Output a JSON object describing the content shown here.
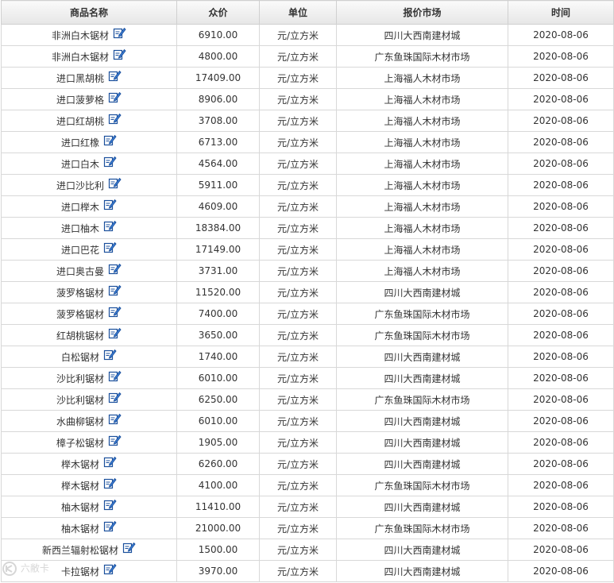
{
  "table": {
    "headers": [
      "商品名称",
      "众价",
      "单位",
      "报价市场",
      "时间"
    ],
    "icon": "edit-note-icon",
    "rows": [
      {
        "name": "非洲白木锯材",
        "price": "6910.00",
        "unit": "元/立方米",
        "market": "四川大西南建材城",
        "date": "2020-08-06"
      },
      {
        "name": "非洲白木锯材",
        "price": "4800.00",
        "unit": "元/立方米",
        "market": "广东鱼珠国际木材市场",
        "date": "2020-08-06"
      },
      {
        "name": "进口黑胡桃",
        "price": "17409.00",
        "unit": "元/立方米",
        "market": "上海福人木材市场",
        "date": "2020-08-06"
      },
      {
        "name": "进口菠萝格",
        "price": "8906.00",
        "unit": "元/立方米",
        "market": "上海福人木材市场",
        "date": "2020-08-06"
      },
      {
        "name": "进口红胡桃",
        "price": "3708.00",
        "unit": "元/立方米",
        "market": "上海福人木材市场",
        "date": "2020-08-06"
      },
      {
        "name": "进口红橡",
        "price": "6713.00",
        "unit": "元/立方米",
        "market": "上海福人木材市场",
        "date": "2020-08-06"
      },
      {
        "name": "进口白木",
        "price": "4564.00",
        "unit": "元/立方米",
        "market": "上海福人木材市场",
        "date": "2020-08-06"
      },
      {
        "name": "进口沙比利",
        "price": "5911.00",
        "unit": "元/立方米",
        "market": "上海福人木材市场",
        "date": "2020-08-06"
      },
      {
        "name": "进口榉木",
        "price": "4609.00",
        "unit": "元/立方米",
        "market": "上海福人木材市场",
        "date": "2020-08-06"
      },
      {
        "name": "进口柚木",
        "price": "18384.00",
        "unit": "元/立方米",
        "market": "上海福人木材市场",
        "date": "2020-08-06"
      },
      {
        "name": "进口巴花",
        "price": "17149.00",
        "unit": "元/立方米",
        "market": "上海福人木材市场",
        "date": "2020-08-06"
      },
      {
        "name": "进口奥古曼",
        "price": "3731.00",
        "unit": "元/立方米",
        "market": "上海福人木材市场",
        "date": "2020-08-06"
      },
      {
        "name": "菠罗格锯材",
        "price": "11520.00",
        "unit": "元/立方米",
        "market": "四川大西南建材城",
        "date": "2020-08-06"
      },
      {
        "name": "菠罗格锯材",
        "price": "7400.00",
        "unit": "元/立方米",
        "market": "广东鱼珠国际木材市场",
        "date": "2020-08-06"
      },
      {
        "name": "红胡桃锯材",
        "price": "3650.00",
        "unit": "元/立方米",
        "market": "广东鱼珠国际木材市场",
        "date": "2020-08-06"
      },
      {
        "name": "白松锯材",
        "price": "1740.00",
        "unit": "元/立方米",
        "market": "四川大西南建材城",
        "date": "2020-08-06"
      },
      {
        "name": "沙比利锯材",
        "price": "6010.00",
        "unit": "元/立方米",
        "market": "四川大西南建材城",
        "date": "2020-08-06"
      },
      {
        "name": "沙比利锯材",
        "price": "6250.00",
        "unit": "元/立方米",
        "market": "广东鱼珠国际木材市场",
        "date": "2020-08-06"
      },
      {
        "name": "水曲柳锯材",
        "price": "6010.00",
        "unit": "元/立方米",
        "market": "四川大西南建材城",
        "date": "2020-08-06"
      },
      {
        "name": "樟子松锯材",
        "price": "1905.00",
        "unit": "元/立方米",
        "market": "四川大西南建材城",
        "date": "2020-08-06"
      },
      {
        "name": "榉木锯材",
        "price": "6260.00",
        "unit": "元/立方米",
        "market": "四川大西南建材城",
        "date": "2020-08-06"
      },
      {
        "name": "榉木锯材",
        "price": "4100.00",
        "unit": "元/立方米",
        "market": "广东鱼珠国际木材市场",
        "date": "2020-08-06"
      },
      {
        "name": "柚木锯材",
        "price": "11410.00",
        "unit": "元/立方米",
        "market": "四川大西南建材城",
        "date": "2020-08-06"
      },
      {
        "name": "柚木锯材",
        "price": "21000.00",
        "unit": "元/立方米",
        "market": "广东鱼珠国际木材市场",
        "date": "2020-08-06"
      },
      {
        "name": "新西兰辐射松锯材",
        "price": "1500.00",
        "unit": "元/立方米",
        "market": "四川大西南建材城",
        "date": "2020-08-06"
      },
      {
        "name": "卡拉锯材",
        "price": "3970.00",
        "unit": "元/立方米",
        "market": "四川大西南建材城",
        "date": "2020-08-06"
      }
    ]
  },
  "watermark": {
    "text": "六敝卡",
    "icon": "watermark-logo-icon"
  },
  "colors": {
    "header_bg": "#e6e6e6",
    "border": "#d0d0d0",
    "text": "#333333",
    "icon": "#1a4f9c"
  }
}
